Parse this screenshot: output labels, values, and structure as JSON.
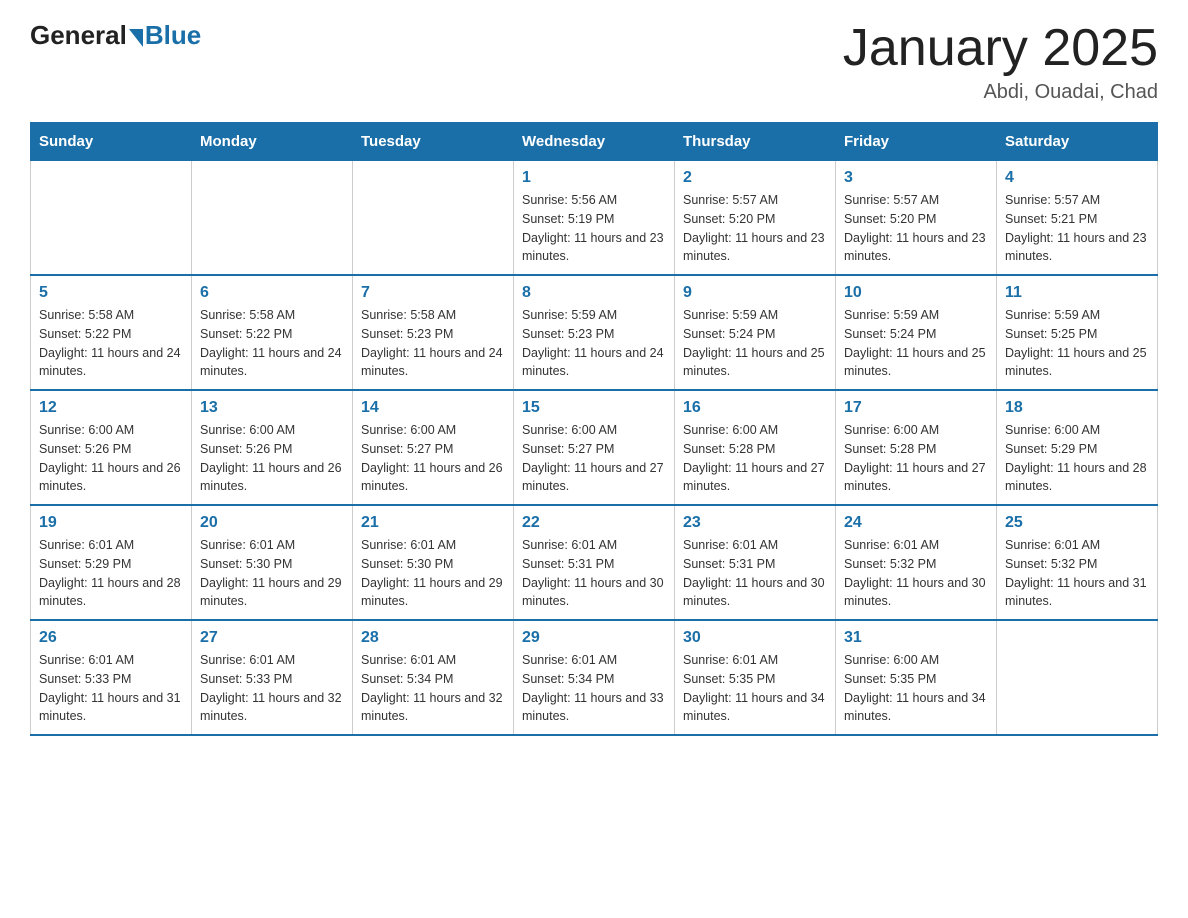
{
  "logo": {
    "general": "General",
    "blue": "Blue"
  },
  "title": "January 2025",
  "subtitle": "Abdi, Ouadai, Chad",
  "days_of_week": [
    "Sunday",
    "Monday",
    "Tuesday",
    "Wednesday",
    "Thursday",
    "Friday",
    "Saturday"
  ],
  "weeks": [
    [
      {
        "day": "",
        "sunrise": "",
        "sunset": "",
        "daylight": ""
      },
      {
        "day": "",
        "sunrise": "",
        "sunset": "",
        "daylight": ""
      },
      {
        "day": "",
        "sunrise": "",
        "sunset": "",
        "daylight": ""
      },
      {
        "day": "1",
        "sunrise": "Sunrise: 5:56 AM",
        "sunset": "Sunset: 5:19 PM",
        "daylight": "Daylight: 11 hours and 23 minutes."
      },
      {
        "day": "2",
        "sunrise": "Sunrise: 5:57 AM",
        "sunset": "Sunset: 5:20 PM",
        "daylight": "Daylight: 11 hours and 23 minutes."
      },
      {
        "day": "3",
        "sunrise": "Sunrise: 5:57 AM",
        "sunset": "Sunset: 5:20 PM",
        "daylight": "Daylight: 11 hours and 23 minutes."
      },
      {
        "day": "4",
        "sunrise": "Sunrise: 5:57 AM",
        "sunset": "Sunset: 5:21 PM",
        "daylight": "Daylight: 11 hours and 23 minutes."
      }
    ],
    [
      {
        "day": "5",
        "sunrise": "Sunrise: 5:58 AM",
        "sunset": "Sunset: 5:22 PM",
        "daylight": "Daylight: 11 hours and 24 minutes."
      },
      {
        "day": "6",
        "sunrise": "Sunrise: 5:58 AM",
        "sunset": "Sunset: 5:22 PM",
        "daylight": "Daylight: 11 hours and 24 minutes."
      },
      {
        "day": "7",
        "sunrise": "Sunrise: 5:58 AM",
        "sunset": "Sunset: 5:23 PM",
        "daylight": "Daylight: 11 hours and 24 minutes."
      },
      {
        "day": "8",
        "sunrise": "Sunrise: 5:59 AM",
        "sunset": "Sunset: 5:23 PM",
        "daylight": "Daylight: 11 hours and 24 minutes."
      },
      {
        "day": "9",
        "sunrise": "Sunrise: 5:59 AM",
        "sunset": "Sunset: 5:24 PM",
        "daylight": "Daylight: 11 hours and 25 minutes."
      },
      {
        "day": "10",
        "sunrise": "Sunrise: 5:59 AM",
        "sunset": "Sunset: 5:24 PM",
        "daylight": "Daylight: 11 hours and 25 minutes."
      },
      {
        "day": "11",
        "sunrise": "Sunrise: 5:59 AM",
        "sunset": "Sunset: 5:25 PM",
        "daylight": "Daylight: 11 hours and 25 minutes."
      }
    ],
    [
      {
        "day": "12",
        "sunrise": "Sunrise: 6:00 AM",
        "sunset": "Sunset: 5:26 PM",
        "daylight": "Daylight: 11 hours and 26 minutes."
      },
      {
        "day": "13",
        "sunrise": "Sunrise: 6:00 AM",
        "sunset": "Sunset: 5:26 PM",
        "daylight": "Daylight: 11 hours and 26 minutes."
      },
      {
        "day": "14",
        "sunrise": "Sunrise: 6:00 AM",
        "sunset": "Sunset: 5:27 PM",
        "daylight": "Daylight: 11 hours and 26 minutes."
      },
      {
        "day": "15",
        "sunrise": "Sunrise: 6:00 AM",
        "sunset": "Sunset: 5:27 PM",
        "daylight": "Daylight: 11 hours and 27 minutes."
      },
      {
        "day": "16",
        "sunrise": "Sunrise: 6:00 AM",
        "sunset": "Sunset: 5:28 PM",
        "daylight": "Daylight: 11 hours and 27 minutes."
      },
      {
        "day": "17",
        "sunrise": "Sunrise: 6:00 AM",
        "sunset": "Sunset: 5:28 PM",
        "daylight": "Daylight: 11 hours and 27 minutes."
      },
      {
        "day": "18",
        "sunrise": "Sunrise: 6:00 AM",
        "sunset": "Sunset: 5:29 PM",
        "daylight": "Daylight: 11 hours and 28 minutes."
      }
    ],
    [
      {
        "day": "19",
        "sunrise": "Sunrise: 6:01 AM",
        "sunset": "Sunset: 5:29 PM",
        "daylight": "Daylight: 11 hours and 28 minutes."
      },
      {
        "day": "20",
        "sunrise": "Sunrise: 6:01 AM",
        "sunset": "Sunset: 5:30 PM",
        "daylight": "Daylight: 11 hours and 29 minutes."
      },
      {
        "day": "21",
        "sunrise": "Sunrise: 6:01 AM",
        "sunset": "Sunset: 5:30 PM",
        "daylight": "Daylight: 11 hours and 29 minutes."
      },
      {
        "day": "22",
        "sunrise": "Sunrise: 6:01 AM",
        "sunset": "Sunset: 5:31 PM",
        "daylight": "Daylight: 11 hours and 30 minutes."
      },
      {
        "day": "23",
        "sunrise": "Sunrise: 6:01 AM",
        "sunset": "Sunset: 5:31 PM",
        "daylight": "Daylight: 11 hours and 30 minutes."
      },
      {
        "day": "24",
        "sunrise": "Sunrise: 6:01 AM",
        "sunset": "Sunset: 5:32 PM",
        "daylight": "Daylight: 11 hours and 30 minutes."
      },
      {
        "day": "25",
        "sunrise": "Sunrise: 6:01 AM",
        "sunset": "Sunset: 5:32 PM",
        "daylight": "Daylight: 11 hours and 31 minutes."
      }
    ],
    [
      {
        "day": "26",
        "sunrise": "Sunrise: 6:01 AM",
        "sunset": "Sunset: 5:33 PM",
        "daylight": "Daylight: 11 hours and 31 minutes."
      },
      {
        "day": "27",
        "sunrise": "Sunrise: 6:01 AM",
        "sunset": "Sunset: 5:33 PM",
        "daylight": "Daylight: 11 hours and 32 minutes."
      },
      {
        "day": "28",
        "sunrise": "Sunrise: 6:01 AM",
        "sunset": "Sunset: 5:34 PM",
        "daylight": "Daylight: 11 hours and 32 minutes."
      },
      {
        "day": "29",
        "sunrise": "Sunrise: 6:01 AM",
        "sunset": "Sunset: 5:34 PM",
        "daylight": "Daylight: 11 hours and 33 minutes."
      },
      {
        "day": "30",
        "sunrise": "Sunrise: 6:01 AM",
        "sunset": "Sunset: 5:35 PM",
        "daylight": "Daylight: 11 hours and 34 minutes."
      },
      {
        "day": "31",
        "sunrise": "Sunrise: 6:00 AM",
        "sunset": "Sunset: 5:35 PM",
        "daylight": "Daylight: 11 hours and 34 minutes."
      },
      {
        "day": "",
        "sunrise": "",
        "sunset": "",
        "daylight": ""
      }
    ]
  ]
}
